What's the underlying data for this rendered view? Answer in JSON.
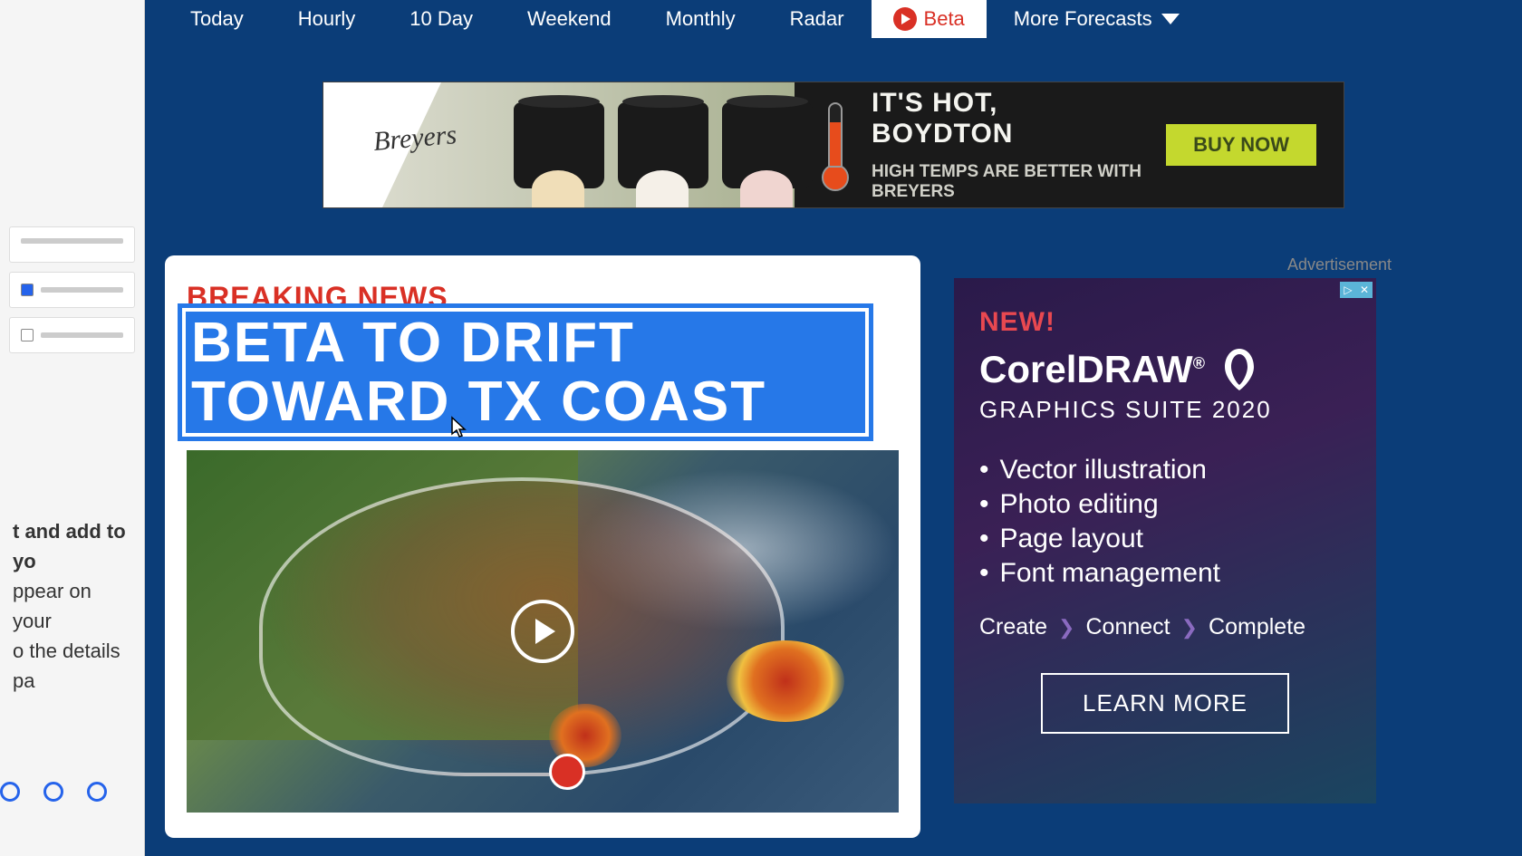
{
  "nav": {
    "items": [
      "Today",
      "Hourly",
      "10 Day",
      "Weekend",
      "Monthly",
      "Radar"
    ],
    "beta": "Beta",
    "more": "More Forecasts"
  },
  "sidebar_fragments": {
    "line1": "t and add to yo",
    "line2": "ppear on your",
    "line3": "o the details pa"
  },
  "banner": {
    "brand": "Breyers",
    "title": "IT'S HOT, BOYDTON",
    "subtitle": "HIGH TEMPS ARE BETTER WITH BREYERS",
    "cta": "BUY NOW"
  },
  "article": {
    "kicker": "BREAKING NEWS",
    "headline": "BETA TO DRIFT TOWARD TX COAST"
  },
  "sidebar_ad": {
    "label": "Advertisement",
    "new_tag": "NEW!",
    "product": "CorelDRAW",
    "suite": "GRAPHICS SUITE 2020",
    "bullets": [
      "Vector illustration",
      "Photo editing",
      "Page layout",
      "Font management"
    ],
    "tagline": [
      "Create",
      "Connect",
      "Complete"
    ],
    "cta": "LEARN MORE"
  }
}
